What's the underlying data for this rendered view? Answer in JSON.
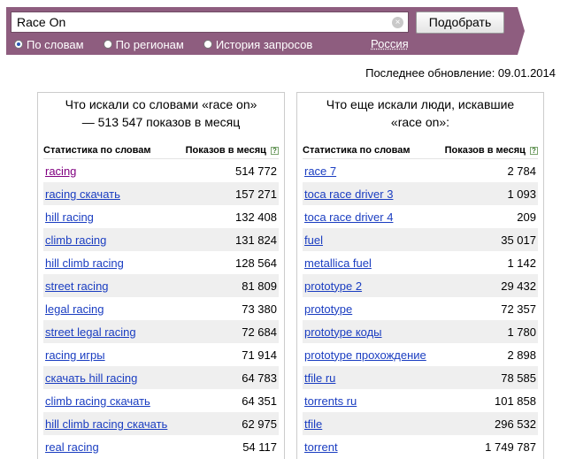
{
  "search": {
    "query": "Race On",
    "submit_label": "Подобрать",
    "clear_symbol": "×"
  },
  "modes": [
    {
      "label": "По словам",
      "selected": true
    },
    {
      "label": "По регионам",
      "selected": false
    },
    {
      "label": "История запросов",
      "selected": false
    }
  ],
  "region": "Россия",
  "last_update": "Последнее обновление: 09.01.2014",
  "left_panel": {
    "title": "Что искали со словами «race on» — 513 547 показов в месяц",
    "col_phrase": "Статистика по словам",
    "col_count": "Показов в месяц",
    "hint": "?",
    "rows": [
      {
        "phrase": "racing",
        "count": "514 772",
        "visited": true
      },
      {
        "phrase": "racing скачать",
        "count": "157 271"
      },
      {
        "phrase": "hill racing",
        "count": "132 408"
      },
      {
        "phrase": "climb racing",
        "count": "131 824"
      },
      {
        "phrase": "hill climb racing",
        "count": "128 564"
      },
      {
        "phrase": "street racing",
        "count": "81 809"
      },
      {
        "phrase": "legal racing",
        "count": "73 380"
      },
      {
        "phrase": "street legal racing",
        "count": "72 684"
      },
      {
        "phrase": "racing игры",
        "count": "71 914"
      },
      {
        "phrase": "скачать hill racing",
        "count": "64 783"
      },
      {
        "phrase": "climb racing скачать",
        "count": "64 351"
      },
      {
        "phrase": "hill climb racing скачать",
        "count": "62 975"
      },
      {
        "phrase": "real racing",
        "count": "54 117"
      }
    ]
  },
  "right_panel": {
    "title": "Что еще искали люди, искавшие «race on»:",
    "col_phrase": "Статистика по словам",
    "col_count": "Показов в месяц",
    "hint": "?",
    "rows": [
      {
        "phrase": "race 7",
        "count": "2 784"
      },
      {
        "phrase": "toca race driver 3",
        "count": "1 093"
      },
      {
        "phrase": "toca race driver 4",
        "count": "209"
      },
      {
        "phrase": "fuel",
        "count": "35 017"
      },
      {
        "phrase": "metallica fuel",
        "count": "1 142"
      },
      {
        "phrase": "prototype 2",
        "count": "29 432"
      },
      {
        "phrase": "prototype",
        "count": "72 357"
      },
      {
        "phrase": "prototype коды",
        "count": "1 780"
      },
      {
        "phrase": "prototype прохождение",
        "count": "2 898"
      },
      {
        "phrase": "tfile ru",
        "count": "78 585"
      },
      {
        "phrase": "torrents ru",
        "count": "101 858"
      },
      {
        "phrase": "tfile",
        "count": "296 532"
      },
      {
        "phrase": "torrent",
        "count": "1 749 787"
      }
    ]
  },
  "colors": {
    "banner": "#8e5d7f",
    "link": "#1a3dc1",
    "visited_link": "#800080",
    "row_stripe": "#efefef"
  }
}
